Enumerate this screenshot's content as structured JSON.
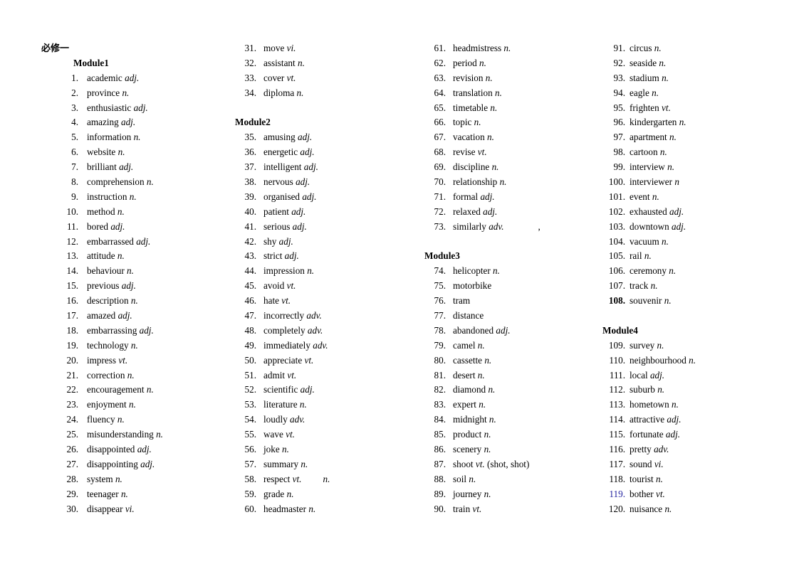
{
  "document": {
    "title": "必修一"
  },
  "columns": [
    {
      "id": "col-1",
      "lines": [
        {
          "type": "title"
        },
        {
          "type": "module",
          "label": "Module1"
        },
        {
          "type": "item",
          "num": "1.",
          "word": "academic",
          "pos": "adj."
        },
        {
          "type": "item",
          "num": "2.",
          "word": "province",
          "pos": "n."
        },
        {
          "type": "item",
          "num": "3.",
          "word": "enthusiastic",
          "pos": "adj."
        },
        {
          "type": "item",
          "num": "4.",
          "word": "amazing",
          "pos": "adj."
        },
        {
          "type": "item",
          "num": "5.",
          "word": "information",
          "pos": "n."
        },
        {
          "type": "item",
          "num": "6.",
          "word": "website",
          "pos": "n."
        },
        {
          "type": "item",
          "num": "7.",
          "word": "brilliant",
          "pos": "adj."
        },
        {
          "type": "item",
          "num": "8.",
          "word": "comprehension",
          "pos": "n."
        },
        {
          "type": "item",
          "num": "9.",
          "word": "instruction",
          "pos": "n."
        },
        {
          "type": "item",
          "num": "10.",
          "word": "method",
          "pos": "n."
        },
        {
          "type": "item",
          "num": "11.",
          "word": "bored",
          "pos": "adj."
        },
        {
          "type": "item",
          "num": "12.",
          "word": "embarrassed",
          "pos": "adj."
        },
        {
          "type": "item",
          "num": "13.",
          "word": "attitude",
          "pos": "n."
        },
        {
          "type": "item",
          "num": "14.",
          "word": "behaviour",
          "pos": "n."
        },
        {
          "type": "item",
          "num": "15.",
          "word": "previous",
          "pos": "adj."
        },
        {
          "type": "item",
          "num": "16.",
          "word": "description",
          "pos": "n."
        },
        {
          "type": "item",
          "num": "17.",
          "word": "amazed",
          "pos": "adj."
        },
        {
          "type": "item",
          "num": "18.",
          "word": "embarrassing",
          "pos": "adj."
        },
        {
          "type": "item",
          "num": "19.",
          "word": "technology",
          "pos": "n."
        },
        {
          "type": "item",
          "num": "20.",
          "word": "impress",
          "pos": "vt."
        },
        {
          "type": "item",
          "num": "21.",
          "word": "correction",
          "pos": "n."
        },
        {
          "type": "item",
          "num": "22.",
          "word": "encouragement",
          "pos": "n."
        },
        {
          "type": "item",
          "num": "23.",
          "word": "enjoyment",
          "pos": "n."
        },
        {
          "type": "item",
          "num": "24.",
          "word": "fluency",
          "pos": "n."
        },
        {
          "type": "item",
          "num": "25.",
          "word": "misunderstanding",
          "pos": "n."
        },
        {
          "type": "item",
          "num": "26.",
          "word": "disappointed",
          "pos": "adj."
        },
        {
          "type": "item",
          "num": "27.",
          "word": "disappointing",
          "pos": "adj."
        },
        {
          "type": "item",
          "num": "28.",
          "word": "system",
          "pos": "n."
        },
        {
          "type": "item",
          "num": "29.",
          "word": "teenager",
          "pos": "n."
        },
        {
          "type": "item",
          "num": "30.",
          "word": "disappear",
          "pos": "vi."
        }
      ]
    },
    {
      "id": "col-2",
      "lines": [
        {
          "type": "item",
          "num": "31.",
          "word": "move",
          "pos": "vi."
        },
        {
          "type": "item",
          "num": "32.",
          "word": "assistant",
          "pos": "n."
        },
        {
          "type": "item",
          "num": "33.",
          "word": "cover",
          "pos": "vt."
        },
        {
          "type": "item",
          "num": "34.",
          "word": "diploma",
          "pos": "n."
        },
        {
          "type": "spacer"
        },
        {
          "type": "module",
          "label": "Module2"
        },
        {
          "type": "item",
          "num": "35.",
          "word": "amusing",
          "pos": "adj."
        },
        {
          "type": "item",
          "num": "36.",
          "word": "energetic",
          "pos": "adj."
        },
        {
          "type": "item",
          "num": "37.",
          "word": "intelligent",
          "pos": "adj."
        },
        {
          "type": "item",
          "num": "38.",
          "word": "nervous",
          "pos": "adj."
        },
        {
          "type": "item",
          "num": "39.",
          "word": "organised",
          "pos": "adj."
        },
        {
          "type": "item",
          "num": "40.",
          "word": "patient",
          "pos": "adj."
        },
        {
          "type": "item",
          "num": "41.",
          "word": "serious",
          "pos": "adj."
        },
        {
          "type": "item",
          "num": "42.",
          "word": "shy",
          "pos": "adj."
        },
        {
          "type": "item",
          "num": "43.",
          "word": "strict",
          "pos": "adj."
        },
        {
          "type": "item",
          "num": "44.",
          "word": "impression",
          "pos": "n."
        },
        {
          "type": "item",
          "num": "45.",
          "word": "avoid",
          "pos": "vt."
        },
        {
          "type": "item",
          "num": "46.",
          "word": "hate",
          "pos": "vt."
        },
        {
          "type": "item",
          "num": "47.",
          "word": "incorrectly",
          "pos": "adv."
        },
        {
          "type": "item",
          "num": "48.",
          "word": "completely",
          "pos": "adv."
        },
        {
          "type": "item",
          "num": "49.",
          "word": "immediately",
          "pos": "adv."
        },
        {
          "type": "item",
          "num": "50.",
          "word": "appreciate",
          "pos": "vt."
        },
        {
          "type": "item",
          "num": "51.",
          "word": "admit",
          "pos": "vt."
        },
        {
          "type": "item",
          "num": "52.",
          "word": "scientific",
          "pos": "adj."
        },
        {
          "type": "item",
          "num": "53.",
          "word": "literature",
          "pos": "n."
        },
        {
          "type": "item",
          "num": "54.",
          "word": "loudly",
          "pos": "adv."
        },
        {
          "type": "item",
          "num": "55.",
          "word": "wave",
          "pos": "vt."
        },
        {
          "type": "item",
          "num": "56.",
          "word": "joke",
          "pos": "n."
        },
        {
          "type": "item",
          "num": "57.",
          "word": "summary",
          "pos": "n."
        },
        {
          "type": "item",
          "num": "58.",
          "word": "respect",
          "pos": "vt.",
          "extra": "n."
        },
        {
          "type": "item",
          "num": "59.",
          "word": "grade",
          "pos": "n."
        },
        {
          "type": "item",
          "num": "60.",
          "word": "headmaster",
          "pos": "n."
        }
      ]
    },
    {
      "id": "col-3",
      "lines": [
        {
          "type": "item",
          "num": "61.",
          "word": "headmistress",
          "pos": "n."
        },
        {
          "type": "item",
          "num": "62.",
          "word": "period",
          "pos": "n."
        },
        {
          "type": "item",
          "num": "63.",
          "word": "revision",
          "pos": "n."
        },
        {
          "type": "item",
          "num": "64.",
          "word": "translation",
          "pos": "n."
        },
        {
          "type": "item",
          "num": "65.",
          "word": "timetable",
          "pos": "n."
        },
        {
          "type": "item",
          "num": "66.",
          "word": "topic",
          "pos": "n."
        },
        {
          "type": "item",
          "num": "67.",
          "word": "vacation",
          "pos": "n."
        },
        {
          "type": "item",
          "num": "68.",
          "word": "revise",
          "pos": "vt."
        },
        {
          "type": "item",
          "num": "69.",
          "word": "discipline",
          "pos": "n."
        },
        {
          "type": "item",
          "num": "70.",
          "word": "relationship",
          "pos": "n."
        },
        {
          "type": "item",
          "num": "71.",
          "word": "formal",
          "pos": "adj."
        },
        {
          "type": "item",
          "num": "72.",
          "word": "relaxed",
          "pos": "adj."
        },
        {
          "type": "item",
          "num": "73.",
          "word": "similarly",
          "pos": "adv.",
          "extra_plain": ","
        },
        {
          "type": "spacer"
        },
        {
          "type": "module",
          "label": "Module3"
        },
        {
          "type": "item",
          "num": "74.",
          "word": "helicopter",
          "pos": "n."
        },
        {
          "type": "item",
          "num": "75.",
          "word": "motorbike",
          "pos": ""
        },
        {
          "type": "item",
          "num": "76.",
          "word": "tram",
          "pos": ""
        },
        {
          "type": "item",
          "num": "77.",
          "word": "distance",
          "pos": ""
        },
        {
          "type": "item",
          "num": "78.",
          "word": "abandoned",
          "pos": "adj."
        },
        {
          "type": "item",
          "num": "79.",
          "word": "camel",
          "pos": "n."
        },
        {
          "type": "item",
          "num": "80.",
          "word": "cassette",
          "pos": "n."
        },
        {
          "type": "item",
          "num": "81.",
          "word": "desert",
          "pos": "n."
        },
        {
          "type": "item",
          "num": "82.",
          "word": "diamond",
          "pos": "n."
        },
        {
          "type": "item",
          "num": "83.",
          "word": "expert",
          "pos": "n."
        },
        {
          "type": "item",
          "num": "84.",
          "word": "midnight",
          "pos": "n."
        },
        {
          "type": "item",
          "num": "85.",
          "word": "product",
          "pos": "n."
        },
        {
          "type": "item",
          "num": "86.",
          "word": "scenery",
          "pos": "n."
        },
        {
          "type": "item",
          "num": "87.",
          "word": "shoot",
          "pos": "vt.",
          "tail": "(shot, shot)"
        },
        {
          "type": "item",
          "num": "88.",
          "word": "soil",
          "pos": "n."
        },
        {
          "type": "item",
          "num": "89.",
          "word": "journey",
          "pos": "n."
        },
        {
          "type": "item",
          "num": "90.",
          "word": "train",
          "pos": "vt."
        }
      ]
    },
    {
      "id": "col-4",
      "lines": [
        {
          "type": "item",
          "num": "91.",
          "word": "circus",
          "pos": "n."
        },
        {
          "type": "item",
          "num": "92.",
          "word": "seaside",
          "pos": "n."
        },
        {
          "type": "item",
          "num": "93.",
          "word": "stadium",
          "pos": "n."
        },
        {
          "type": "item",
          "num": "94.",
          "word": "eagle",
          "pos": "n."
        },
        {
          "type": "item",
          "num": "95.",
          "word": "frighten",
          "pos": "vt."
        },
        {
          "type": "item",
          "num": "96.",
          "word": "kindergarten",
          "pos": "n."
        },
        {
          "type": "item",
          "num": "97.",
          "word": "apartment",
          "pos": "n."
        },
        {
          "type": "item",
          "num": "98.",
          "word": "cartoon",
          "pos": "n."
        },
        {
          "type": "item",
          "num": "99.",
          "word": "interview",
          "pos": "n."
        },
        {
          "type": "item",
          "num": "100.",
          "word": "interviewer",
          "pos": "n"
        },
        {
          "type": "item",
          "num": "101.",
          "word": "event",
          "pos": "n."
        },
        {
          "type": "item",
          "num": "102.",
          "word": "exhausted",
          "pos": "adj."
        },
        {
          "type": "item",
          "num": "103.",
          "word": "downtown",
          "pos": "adj."
        },
        {
          "type": "item",
          "num": "104.",
          "word": "vacuum",
          "pos": "n."
        },
        {
          "type": "item",
          "num": "105.",
          "word": "rail",
          "pos": "n."
        },
        {
          "type": "item",
          "num": "106.",
          "word": "ceremony",
          "pos": "n."
        },
        {
          "type": "item",
          "num": "107.",
          "word": "track",
          "pos": "n."
        },
        {
          "type": "item",
          "num": "108.",
          "word": "souvenir",
          "pos": "n.",
          "num_style": "bold"
        },
        {
          "type": "spacer"
        },
        {
          "type": "module",
          "label": "Module4"
        },
        {
          "type": "item",
          "num": "109.",
          "word": "survey",
          "pos": "n."
        },
        {
          "type": "item",
          "num": "110.",
          "word": "neighbourhood",
          "pos": "n."
        },
        {
          "type": "item",
          "num": "111.",
          "word": "local",
          "pos": "adj."
        },
        {
          "type": "item",
          "num": "112.",
          "word": "suburb",
          "pos": "n."
        },
        {
          "type": "item",
          "num": "113.",
          "word": "hometown",
          "pos": "n."
        },
        {
          "type": "item",
          "num": "114.",
          "word": "attractive",
          "pos": "adj."
        },
        {
          "type": "item",
          "num": "115.",
          "word": "fortunate",
          "pos": "adj."
        },
        {
          "type": "item",
          "num": "116.",
          "word": "pretty",
          "pos": "adv."
        },
        {
          "type": "item",
          "num": "117.",
          "word": "sound",
          "pos": "vi."
        },
        {
          "type": "item",
          "num": "118.",
          "word": "tourist",
          "pos": "n."
        },
        {
          "type": "item",
          "num": "119.",
          "word": "bother",
          "pos": "vt.",
          "num_style": "blue"
        },
        {
          "type": "item",
          "num": "120.",
          "word": "nuisance",
          "pos": "n."
        }
      ]
    }
  ],
  "colors": {
    "text": "#000000",
    "highlight_number": "#2424a0",
    "page_background": "#ffffff"
  }
}
